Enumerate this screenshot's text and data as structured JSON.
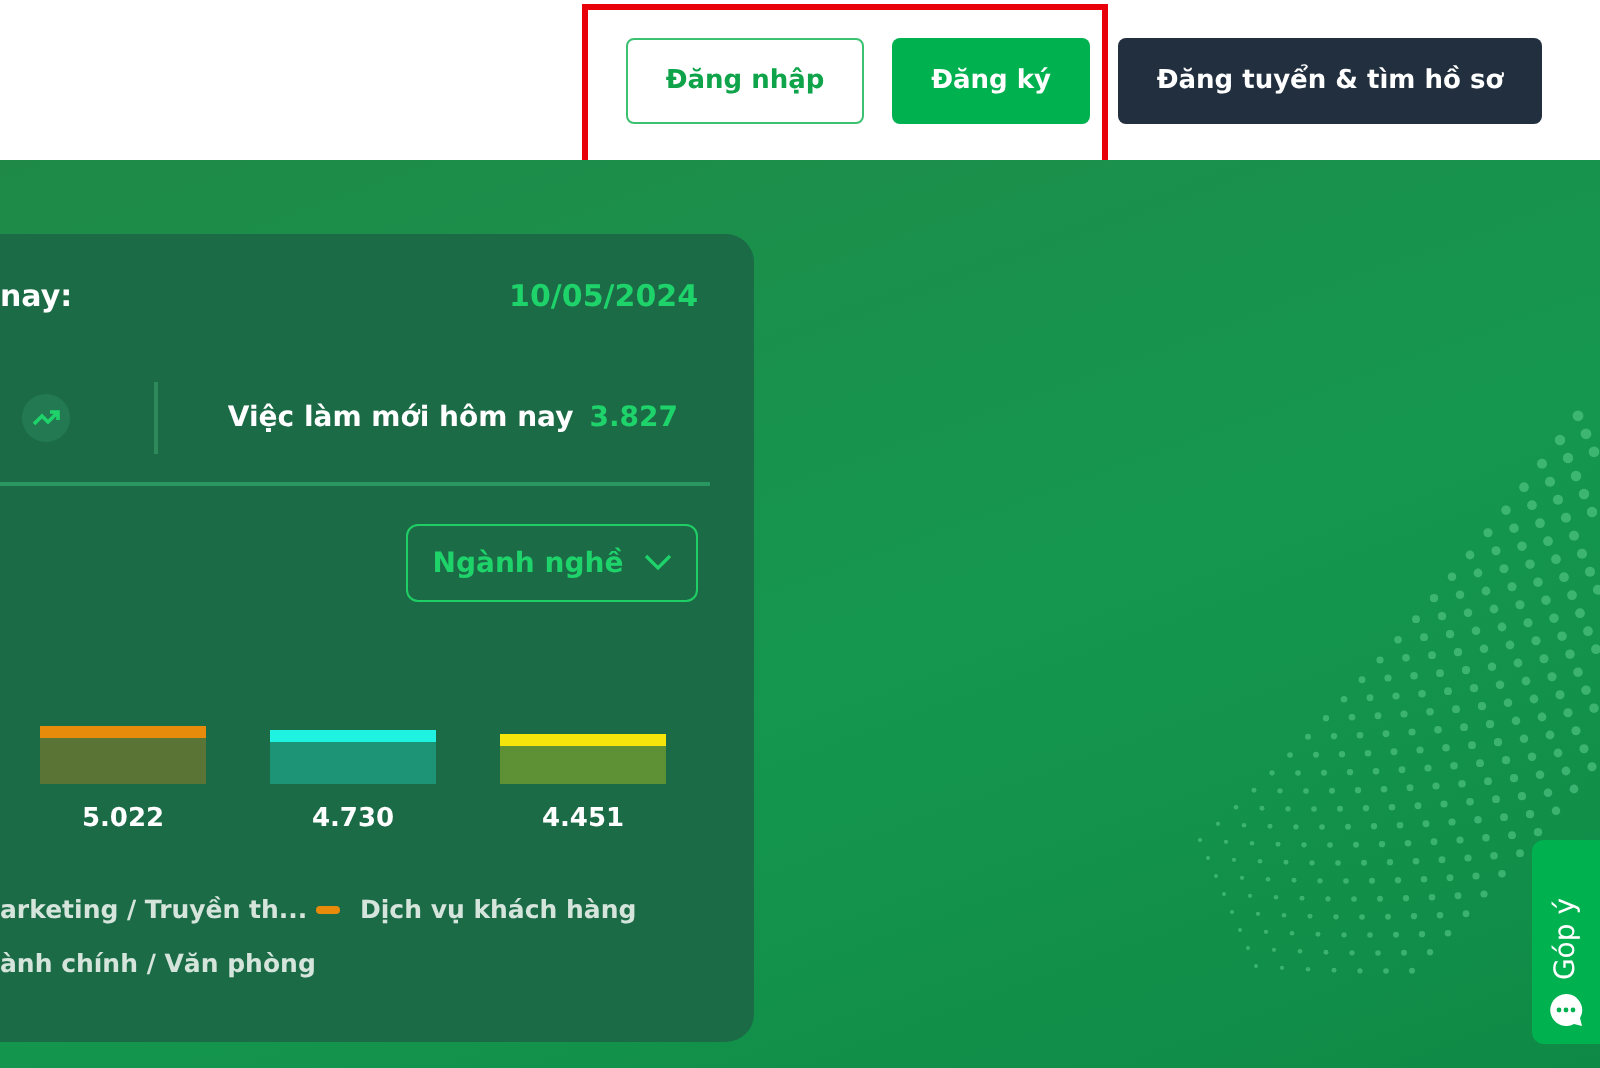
{
  "header": {
    "buttons": [
      {
        "label": "Đăng nhập",
        "kind": "outline"
      },
      {
        "label": "Đăng ký",
        "kind": "primary"
      },
      {
        "label": "Đăng tuyển & tìm hồ sơ",
        "kind": "dark"
      }
    ]
  },
  "stats_card": {
    "title": "nay:",
    "date": "10/05/2024",
    "new_jobs_label": "Việc làm mới hôm nay",
    "new_jobs_count": "3.827",
    "filter": {
      "value": "Ngành nghề"
    },
    "bars": [
      {
        "value": "5.022",
        "color": "#e88a0a"
      },
      {
        "value": "4.730",
        "color": "#1ff2e0"
      },
      {
        "value": "4.451",
        "color": "#f5e50a"
      }
    ],
    "legend": [
      {
        "label": "arketing / Truyền th..."
      },
      {
        "label": "Dịch vụ khách hàng",
        "color": "#e88a0a"
      },
      {
        "label": "ành chính / Văn phòng"
      }
    ]
  },
  "feedback_tab": {
    "label": "Góp ý"
  }
}
